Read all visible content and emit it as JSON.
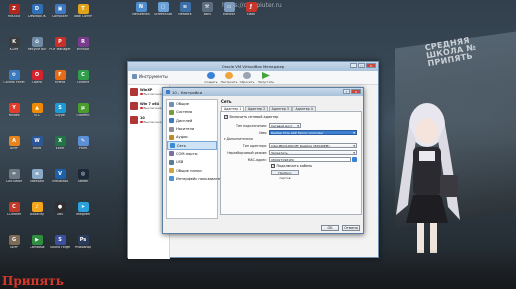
{
  "desktop": {
    "watermark_url": "https://compiuter.ru",
    "caption": "Припять",
    "sign_text": "СРЕДНЯЯ\nШКОЛА №\nПРИПЯТЬ",
    "left_icons": [
      {
        "label": "FileZilla",
        "color": "#b3261e",
        "glyph": "Z"
      },
      {
        "label": "DesktopOK",
        "color": "#2f6fb7",
        "glyph": "D"
      },
      {
        "label": "Computer",
        "color": "#3b78c0",
        "glyph": "▣"
      },
      {
        "label": "Total Comm",
        "color": "#e0a319",
        "glyph": "T"
      },
      {
        "label": "K-Lite",
        "color": "#3c3c3c",
        "glyph": "K"
      },
      {
        "label": "Recycle Bin",
        "color": "#6f8aa3",
        "glyph": "♻"
      },
      {
        "label": "PDF Manager",
        "color": "#c8302b",
        "glyph": "P"
      },
      {
        "label": "WinRAR",
        "color": "#7a3b8f",
        "glyph": "R"
      },
      {
        "label": "Control Panel",
        "color": "#3a7bbf",
        "glyph": "⚙"
      },
      {
        "label": "Opera",
        "color": "#d4232f",
        "glyph": "O"
      },
      {
        "label": "Firefox",
        "color": "#e36b17",
        "glyph": "F"
      },
      {
        "label": "Chrome",
        "color": "#2f9e4a",
        "glyph": "C"
      },
      {
        "label": "Yandex",
        "color": "#e23d28",
        "glyph": "Y"
      },
      {
        "label": "VLC",
        "color": "#f08a00",
        "glyph": "▲"
      },
      {
        "label": "Skype",
        "color": "#1b9ad8",
        "glyph": "S"
      },
      {
        "label": "uTorrent",
        "color": "#4b9c2e",
        "glyph": "μ"
      },
      {
        "label": "AIMP",
        "color": "#e8841a",
        "glyph": "A"
      },
      {
        "label": "Word",
        "color": "#2b579a",
        "glyph": "W"
      },
      {
        "label": "Excel",
        "color": "#217346",
        "glyph": "X"
      },
      {
        "label": "Paint",
        "color": "#5c8fd6",
        "glyph": "✎"
      },
      {
        "label": "Calculator",
        "color": "#6d7a86",
        "glyph": "="
      },
      {
        "label": "Notepad",
        "color": "#8aa9c7",
        "glyph": "≡"
      },
      {
        "label": "VirtualBox",
        "color": "#1d5fa8",
        "glyph": "V"
      },
      {
        "label": "Steam",
        "color": "#1b2838",
        "glyph": "◎"
      },
      {
        "label": "CCleaner",
        "color": "#c0392b",
        "glyph": "C"
      },
      {
        "label": "Audacity",
        "color": "#f3a61c",
        "glyph": "♪"
      },
      {
        "label": "OBS",
        "color": "#302e31",
        "glyph": "●"
      },
      {
        "label": "Telegram",
        "color": "#2aa1da",
        "glyph": "➤"
      },
      {
        "label": "GIMP",
        "color": "#7d6b55",
        "glyph": "G"
      },
      {
        "label": "Camtasia",
        "color": "#2f8f3f",
        "glyph": "▶"
      },
      {
        "label": "Sound Forge",
        "color": "#3b4f9c",
        "glyph": "S"
      },
      {
        "label": "Photoshop",
        "color": "#2b3b5a",
        "glyph": "Ps"
      }
    ],
    "top_icons": [
      {
        "label": "NetSetMan",
        "color": "#4d8ccd",
        "glyph": "N"
      },
      {
        "label": "Screenshot",
        "color": "#6aa0d8",
        "glyph": "▢"
      },
      {
        "label": "Network",
        "color": "#3c6fa8",
        "glyph": "≋"
      },
      {
        "label": "Tools",
        "color": "#5d6e80",
        "glyph": "⚒"
      },
      {
        "label": "Monitor",
        "color": "#7d99bb",
        "glyph": "▭"
      },
      {
        "label": "Flash",
        "color": "#c7342a",
        "glyph": "ƒ"
      }
    ]
  },
  "manager": {
    "title": "Oracle VM VirtualBox Менеджер",
    "tools_label": "Инструменты",
    "toolbar": [
      "Создать",
      "Настроить",
      "Сбросить",
      "Запустить"
    ],
    "vms": [
      {
        "name": "WinXP",
        "state": "Выключена"
      },
      {
        "name": "Win 7 x64",
        "state": "Выключена"
      },
      {
        "name": "10",
        "state": "Выключена"
      }
    ]
  },
  "dialog": {
    "title": "10 - Настройки",
    "categories": [
      {
        "label": "Общие",
        "color": "#6b8fb8"
      },
      {
        "label": "Система",
        "color": "#7a9a3b"
      },
      {
        "label": "Дисплей",
        "color": "#3d7ac2"
      },
      {
        "label": "Носители",
        "color": "#8a8f95"
      },
      {
        "label": "Аудио",
        "color": "#c18a2a"
      },
      {
        "label": "Сеть",
        "color": "#3b8ad4"
      },
      {
        "label": "COM-порты",
        "color": "#7b6fa3"
      },
      {
        "label": "USB",
        "color": "#5a7d9a"
      },
      {
        "label": "Общие папки",
        "color": "#d1a43b"
      },
      {
        "label": "Интерфейс пользователя",
        "color": "#4f93cf"
      }
    ],
    "selected_category": "Сеть",
    "section_title": "Сеть",
    "tabs": [
      "Адаптер 1",
      "Адаптер 2",
      "Адаптер 3",
      "Адаптер 4"
    ],
    "enable_label": "Включить сетевой адаптер",
    "fields": [
      {
        "label": "Тип подключения:",
        "value": "Сетевой мост"
      },
      {
        "label": "Имя:",
        "value": "Realtek PCIe GbE Family Controller"
      },
      {
        "label": "Дополнительно",
        "value": ""
      },
      {
        "label": "Тип адаптера:",
        "value": "Intel PRO/1000 MT Desktop (82540EM)"
      },
      {
        "label": "Неразборчивый режим:",
        "value": "Запретить"
      },
      {
        "label": "MAC-адрес:",
        "value": "0800270981E0"
      }
    ],
    "cable_label": "Подключить кабель",
    "port_forward_label": "Проброс портов",
    "ok_label": "OK",
    "cancel_label": "Отмена"
  }
}
